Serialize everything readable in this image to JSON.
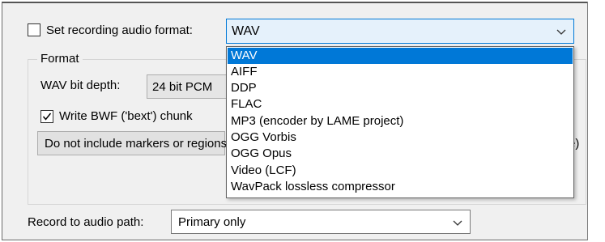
{
  "recording_format": {
    "checkbox_label": "Set recording audio format:",
    "checked": false,
    "selected_value": "WAV",
    "options": [
      "WAV",
      "AIFF",
      "DDP",
      "FLAC",
      "MP3 (encoder by LAME project)",
      "OGG Vorbis",
      "OGG Opus",
      "Video (LCF)",
      "WavPack lossless compressor"
    ],
    "highlighted_option": "WAV"
  },
  "format_group": {
    "title": "Format",
    "bit_depth_label": "WAV bit depth:",
    "bit_depth_value": "24 bit PCM",
    "bwf_label": "Write BWF ('bext') chunk",
    "bwf_checked": true,
    "markers_value": "Do not include markers or regions",
    "markers_tail": "e)"
  },
  "audio_path": {
    "label": "Record to audio path:",
    "value": "Primary only"
  },
  "colors": {
    "selection": "#0078d7",
    "panel_bg": "#f0f0f0"
  }
}
